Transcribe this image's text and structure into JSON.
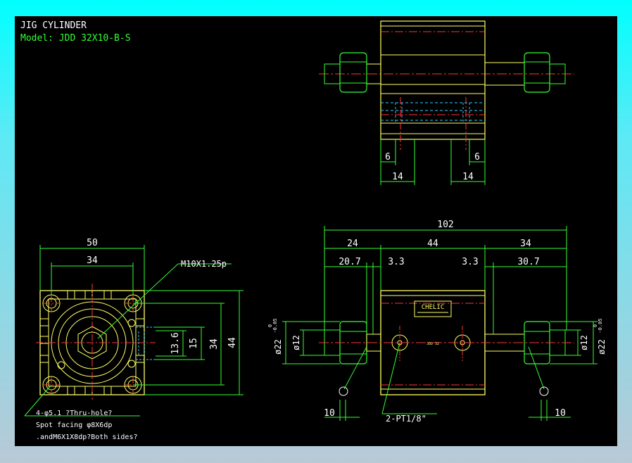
{
  "title": "JIG CYLINDER",
  "model": "Model: JDD 32X10-B-S",
  "colors": {
    "background": "#000000",
    "outline": "#ffff66",
    "dimension": "#33ff33",
    "centerline": "#ff3333",
    "hidden": "#33ccff",
    "text": "#ffffff"
  },
  "top_view": {
    "dims": {
      "left_small": "6",
      "right_small": "6",
      "left_width": "14",
      "right_width": "14"
    }
  },
  "side_view": {
    "width": "50",
    "hole_pitch": "34",
    "thread_label": "M10X1.25p",
    "h1": "13.6",
    "h2": "15",
    "h3": "34",
    "h4": "44",
    "note_1": "4-φ5.1 ?Thru-hole?",
    "note_2": "Spot facing φ8X6dp",
    "note_3": ".andM6X1X8dp?Both sides?"
  },
  "front_view": {
    "overall": "102",
    "seg_left": "24",
    "seg_mid": "44",
    "seg_right": "34",
    "sub_left": "20.7",
    "sub_left_b": "3.3",
    "sub_right_b": "3.3",
    "sub_right": "30.7",
    "dia_left_inner": "ø12",
    "dia_left_outer": "ø22",
    "tol_left_top": "0",
    "tol_left_bot": "-0.05",
    "dia_right_inner": "ø12",
    "dia_right_outer": "ø22",
    "tol_right_top": "0",
    "tol_right_bot": "-0.05",
    "port_label": "2-PT1/8\"",
    "left_bottom": "10",
    "right_bottom": "10",
    "brand": "CHELIC",
    "body_mark": "JDD 32"
  }
}
